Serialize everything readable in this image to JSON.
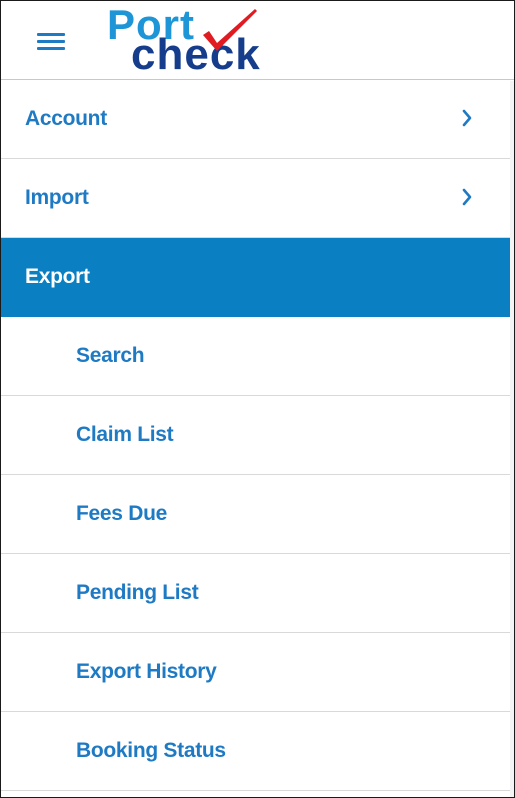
{
  "header": {
    "logo_word_top": "Port",
    "logo_word_bottom": "check",
    "menu_icon": "hamburger-menu-icon"
  },
  "menu": {
    "items": [
      {
        "label": "Account",
        "type": "top",
        "icon": "chevron-right-icon"
      },
      {
        "label": "Import",
        "type": "top",
        "icon": "chevron-right-icon"
      },
      {
        "label": "Export",
        "type": "top",
        "active": true
      },
      {
        "label": "Search",
        "type": "sub"
      },
      {
        "label": "Claim List",
        "type": "sub"
      },
      {
        "label": "Fees Due",
        "type": "sub"
      },
      {
        "label": "Pending List",
        "type": "sub"
      },
      {
        "label": "Export History",
        "type": "sub"
      },
      {
        "label": "Booking Status",
        "type": "sub"
      }
    ]
  },
  "colors": {
    "accent": "#0a7fc1",
    "link": "#1f7ac4",
    "logo_port": "#1e95d6",
    "logo_check": "#163d8c",
    "logo_tick": "#e11b22"
  }
}
